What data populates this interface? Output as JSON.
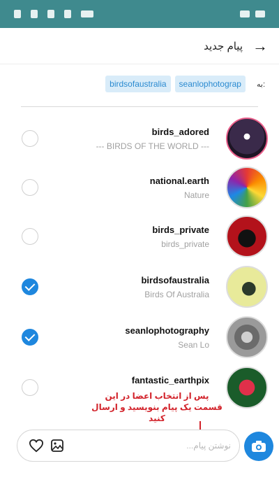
{
  "header": {
    "title": "پیام جدید",
    "back_icon": "arrow-right-icon"
  },
  "recipients": {
    "to_label": "به:",
    "chips": [
      "birdsofaustralia",
      "seanlophotograp"
    ]
  },
  "contacts": [
    {
      "username": "birds_adored",
      "fullname": "--- BIRDS OF THE WORLD ---",
      "selected": false,
      "story": true
    },
    {
      "username": "national.earth",
      "fullname": "Nature",
      "selected": false,
      "story": false
    },
    {
      "username": "birds_private",
      "fullname": "birds_private",
      "selected": false,
      "story": false
    },
    {
      "username": "birdsofaustralia",
      "fullname": "Birds Of Australia",
      "selected": true,
      "story": false
    },
    {
      "username": "seanlophotography",
      "fullname": "Sean Lo",
      "selected": true,
      "story": false
    },
    {
      "username": "fantastic_earthpix",
      "fullname": "",
      "selected": false,
      "story": false
    }
  ],
  "annotation": {
    "text": "پس از انتخاب اعضا در این قسمت یک پیام بنویسید و ارسال کنید"
  },
  "composer": {
    "placeholder": "نوشتن پیام...",
    "value": ""
  },
  "colors": {
    "accent": "#1e87de",
    "chip_bg": "#d9ecf9",
    "annotation": "#d2222a"
  }
}
